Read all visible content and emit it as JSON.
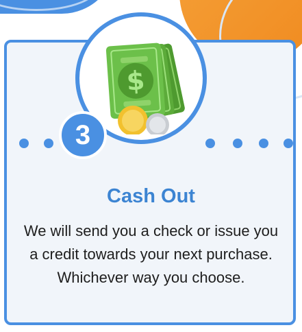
{
  "step": {
    "number": "3",
    "title": "Cash Out",
    "description": "We will send you a check or issue you a credit towards your next purchase. Whichever way you choose."
  },
  "icons": {
    "main": "cash-money-icon"
  },
  "colors": {
    "primary_blue": "#4a90e2",
    "title_blue": "#3c84d2",
    "accent_orange": "#f08a1f",
    "card_background": "#f1f5fa",
    "money_green": "#5cab3a",
    "coin_gold": "#f2c12e",
    "coin_silver": "#c9cdd2"
  }
}
